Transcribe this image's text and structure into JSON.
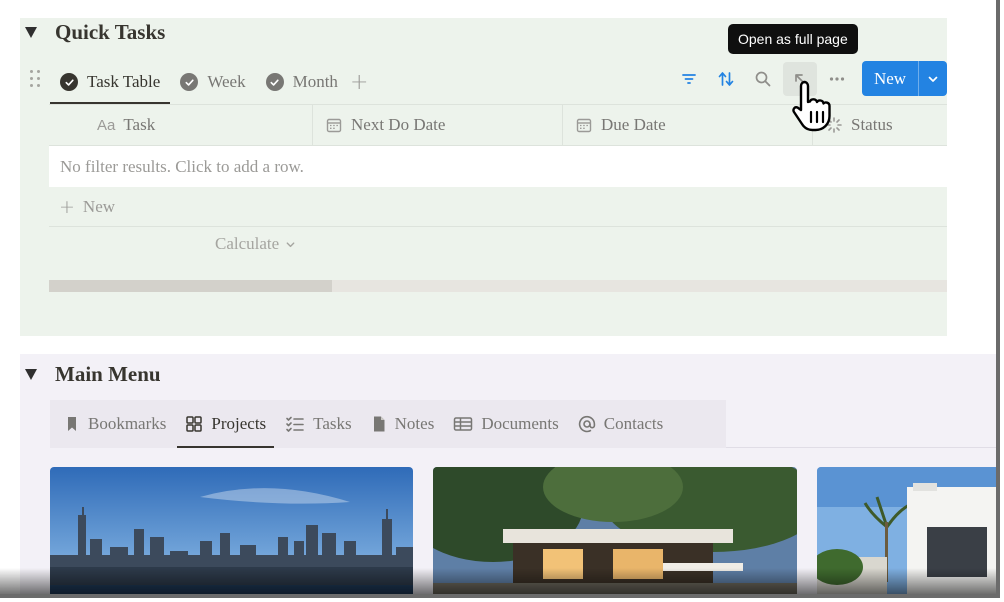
{
  "quick_tasks": {
    "title": "Quick Tasks",
    "views": [
      {
        "label": "Task Table",
        "active": true
      },
      {
        "label": "Week",
        "active": false
      },
      {
        "label": "Month",
        "active": false
      }
    ],
    "add_view_icon": "plus-icon",
    "toolbar_icons": [
      "filter-icon",
      "sort-icon",
      "search-icon",
      "open-full-page-icon",
      "more-icon"
    ],
    "tooltip": "Open as full page",
    "new_button": "New",
    "columns": [
      {
        "icon": "text-icon",
        "icon_text": "Aa",
        "label": "Task"
      },
      {
        "icon": "calendar-icon",
        "label": "Next Do Date"
      },
      {
        "icon": "calendar-icon",
        "label": "Due Date"
      },
      {
        "icon": "status-icon",
        "label": "Status"
      }
    ],
    "empty_message": "No filter results. Click to add a row.",
    "new_row": "New",
    "calculate": "Calculate",
    "accent_color": "#2383e2",
    "background_color": "#edf3ec"
  },
  "main_menu": {
    "title": "Main Menu",
    "tabs": [
      {
        "icon": "bookmark-icon",
        "label": "Bookmarks",
        "active": false
      },
      {
        "icon": "gallery-icon",
        "label": "Projects",
        "active": true
      },
      {
        "icon": "checklist-icon",
        "label": "Tasks",
        "active": false
      },
      {
        "icon": "document-icon",
        "label": "Notes",
        "active": false
      },
      {
        "icon": "table-icon",
        "label": "Documents",
        "active": false
      },
      {
        "icon": "at-icon",
        "label": "Contacts",
        "active": false
      }
    ],
    "cards": [
      {
        "image": "city-skyline-image"
      },
      {
        "image": "modern-house-image"
      },
      {
        "image": "white-villa-image"
      }
    ],
    "background_color": "#f3f1f7"
  }
}
